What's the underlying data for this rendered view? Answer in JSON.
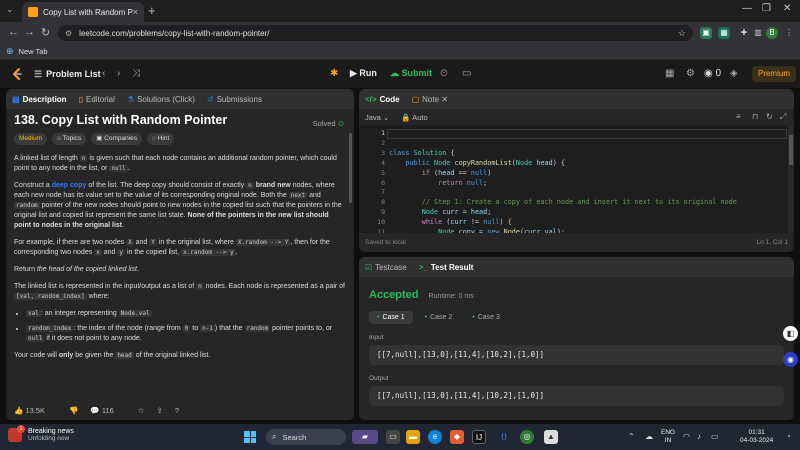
{
  "browser": {
    "tab_title": "Copy List with Random Pointer",
    "tab_close": "×",
    "new_tab_plus": "+",
    "url": "leetcode.com/problems/copy-list-with-random-pointer/",
    "bookmark_newtab": "New Tab",
    "profile_initial": "B"
  },
  "lc_nav": {
    "problem_list": "Problem List",
    "run": "Run",
    "submit": "Submit",
    "streak_count": "0",
    "premium": "Premium"
  },
  "desc_tabs": [
    {
      "label": "Description",
      "icon": "description-icon"
    },
    {
      "label": "Editorial",
      "icon": "editorial-icon"
    },
    {
      "label": "Solutions",
      "icon": "solutions-icon"
    },
    {
      "label": "(Click)",
      "icon": ""
    },
    {
      "label": "Submissions",
      "icon": "submissions-icon"
    }
  ],
  "problem": {
    "title": "138. Copy List with Random Pointer",
    "solved": "Solved",
    "difficulty": "Medium",
    "topics": "Topics",
    "companies": "Companies",
    "hint": "Hint",
    "p1_a": "A linked list of length ",
    "p1_n": "n",
    "p1_b": " is given such that each node contains an additional random pointer, which could point to any node in the list, or ",
    "p1_null": "null",
    "p1_c": ".",
    "p2_a": "Construct a ",
    "p2_link": "deep copy",
    "p2_b": " of the list. The deep copy should consist of exactly ",
    "p2_n": "n",
    "p2_bold1": " brand new",
    "p2_c": " nodes, where each new node has its value set to the value of its corresponding original node. Both the ",
    "p2_next": "next",
    "p2_d": " and ",
    "p2_random": "random",
    "p2_e": " pointer of the new nodes should point to new nodes in the copied list such that the pointers in the original list and copied list represent the same list state. ",
    "p2_bold2": "None of the pointers in the new list should point to nodes in the original list",
    "p2_f": ".",
    "p3_a": "For example, if there are two nodes ",
    "p3_X": "X",
    "p3_b": " and ",
    "p3_Y": "Y",
    "p3_c": " in the original list, where ",
    "p3_xr": "X.random --> Y",
    "p3_d": ", then for the corresponding two nodes ",
    "p3_x": "x",
    "p3_e": " and ",
    "p3_y": "y",
    "p3_f": " in the copied list, ",
    "p3_xr2": "x.random --> y",
    "p3_g": ".",
    "p4_a": "Return ",
    "p4_i": "the head of the copied linked list",
    "p4_b": ".",
    "p5_a": "The linked list is represented in the input/output as a list of ",
    "p5_n": "n",
    "p5_b": " nodes. Each node is represented as a pair of ",
    "p5_pair": "[val, random_index]",
    "p5_c": " where:",
    "li1_code": "val",
    "li1_a": ": an integer representing ",
    "li1_code2": "Node.val",
    "li2_code": "random_index",
    "li2_a": ": the index of the node (range from ",
    "li2_0": "0",
    "li2_b": " to ",
    "li2_n1": "n-1",
    "li2_c": ") that the ",
    "li2_random": "random",
    "li2_d": " pointer points to, or ",
    "li2_null": "null",
    "li2_e": " if it does not point to any node.",
    "p6_a": "Your code will ",
    "p6_b": "only",
    "p6_c": " be given the ",
    "p6_head": "head",
    "p6_d": " of the original linked list."
  },
  "desc_footer": {
    "likes": "13.5K",
    "comments": "116"
  },
  "code_panel": {
    "tab_code": "Code",
    "tab_note": "Note",
    "language": "Java",
    "auto": "Auto",
    "saved": "Saved to local",
    "position": "Ln 1, Col 1",
    "line_numbers": [
      "1",
      "2",
      "3",
      "4",
      "5",
      "6",
      "7",
      "8",
      "9",
      "10",
      "11"
    ]
  },
  "test_panel": {
    "tab_testcase": "Testcase",
    "tab_result": "Test Result",
    "status": "Accepted",
    "runtime": "Runtime: 0 ms",
    "cases": [
      "Case 1",
      "Case 2",
      "Case 3"
    ],
    "input_label": "Input",
    "input_value": "[[7,null],[13,0],[11,4],[10,2],[1,0]]",
    "output_label": "Output",
    "output_value": "[[7,null],[13,0],[11,4],[10,2],[1,0]]"
  },
  "taskbar": {
    "news_title": "Breaking news",
    "news_sub": "Unfolding now",
    "news_badge": "1",
    "search": "Search",
    "lang1": "ENG",
    "lang2": "IN",
    "time": "01:31",
    "date": "04-03-2024"
  },
  "colors": {
    "accent_orange": "#ffa116",
    "accepted_green": "#2cbb5d",
    "link_blue": "#2e7cf6",
    "medium_yellow": "#ffb800"
  }
}
